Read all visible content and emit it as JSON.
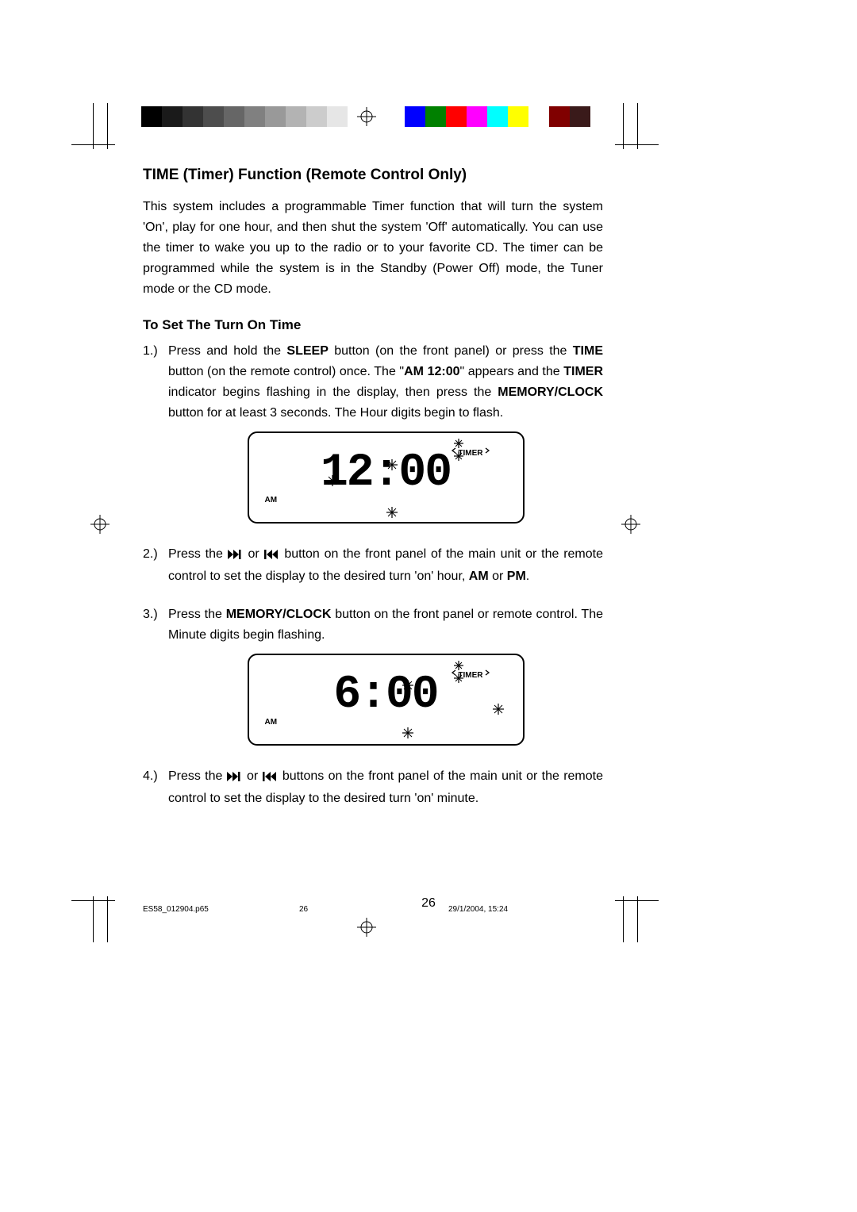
{
  "heading": "TIME (Timer) Function (Remote Control Only)",
  "intro": "This system includes a programmable Timer function that will turn the system 'On', play for one hour, and then shut the system 'Off' automatically. You can use the timer to wake you up to the radio or to your favorite CD. The timer can be programmed while the system is in the Standby (Power Off) mode, the Tuner mode or the CD mode.",
  "subheading": "To Set The Turn On Time",
  "steps": [
    {
      "num": "1.)",
      "parts": [
        {
          "t": "plain",
          "v": "Press and hold the "
        },
        {
          "t": "bold",
          "v": "SLEEP"
        },
        {
          "t": "plain",
          "v": " button (on the front panel) or press the "
        },
        {
          "t": "bold",
          "v": "TIME"
        },
        {
          "t": "plain",
          "v": " button (on the remote control) once. The \""
        },
        {
          "t": "bold",
          "v": "AM 12:00"
        },
        {
          "t": "plain",
          "v": "\" appears and the "
        },
        {
          "t": "bold",
          "v": "TIMER"
        },
        {
          "t": "plain",
          "v": " indicator begins flashing in the display, then press the "
        },
        {
          "t": "bold",
          "v": "MEMORY/CLOCK"
        },
        {
          "t": "plain",
          "v": " button for at least 3 seconds. The Hour digits begin to flash."
        }
      ],
      "lcd": {
        "am": "AM",
        "timer": "TIMER",
        "digits": "12:00",
        "flash_timer": true,
        "flash_hours": true
      }
    },
    {
      "num": "2.)",
      "parts": [
        {
          "t": "plain",
          "v": "Press the "
        },
        {
          "t": "icon",
          "v": "ff"
        },
        {
          "t": "plain",
          "v": " or "
        },
        {
          "t": "icon",
          "v": "rw"
        },
        {
          "t": "plain",
          "v": " button on the front panel of the main unit or the remote control to set the display to the desired turn 'on' hour, "
        },
        {
          "t": "bold",
          "v": "AM"
        },
        {
          "t": "plain",
          "v": " or "
        },
        {
          "t": "bold",
          "v": "PM"
        },
        {
          "t": "plain",
          "v": "."
        }
      ]
    },
    {
      "num": "3.)",
      "parts": [
        {
          "t": "plain",
          "v": "Press the "
        },
        {
          "t": "bold",
          "v": "MEMORY/CLOCK"
        },
        {
          "t": "plain",
          "v": " button on the front panel or remote control. The Minute digits begin flashing."
        }
      ],
      "lcd": {
        "am": "AM",
        "timer": "TIMER",
        "digits": "6:00",
        "flash_timer": true,
        "flash_minutes": true
      }
    },
    {
      "num": "4.)",
      "parts": [
        {
          "t": "plain",
          "v": "Press the "
        },
        {
          "t": "icon",
          "v": "ff"
        },
        {
          "t": "plain",
          "v": " or "
        },
        {
          "t": "icon",
          "v": "rw"
        },
        {
          "t": "plain",
          "v": " buttons on the front panel of the main unit or the remote control to set the display to the desired turn 'on' minute."
        }
      ]
    }
  ],
  "page_number": "26",
  "footer_file": "ES58_012904.p65",
  "footer_page": "26",
  "footer_date": "29/1/2004, 15:24",
  "grayscale": [
    "#000000",
    "#1a1a1a",
    "#333333",
    "#4d4d4d",
    "#666666",
    "#808080",
    "#999999",
    "#b3b3b3",
    "#cccccc",
    "#e6e6e6",
    "#ffffff"
  ],
  "colors": [
    "#0000ff",
    "#008000",
    "#ff0000",
    "#ff00ff",
    "#00ffff",
    "#ffff00",
    "#ffffff",
    "#800000",
    "#3a1a1a"
  ]
}
